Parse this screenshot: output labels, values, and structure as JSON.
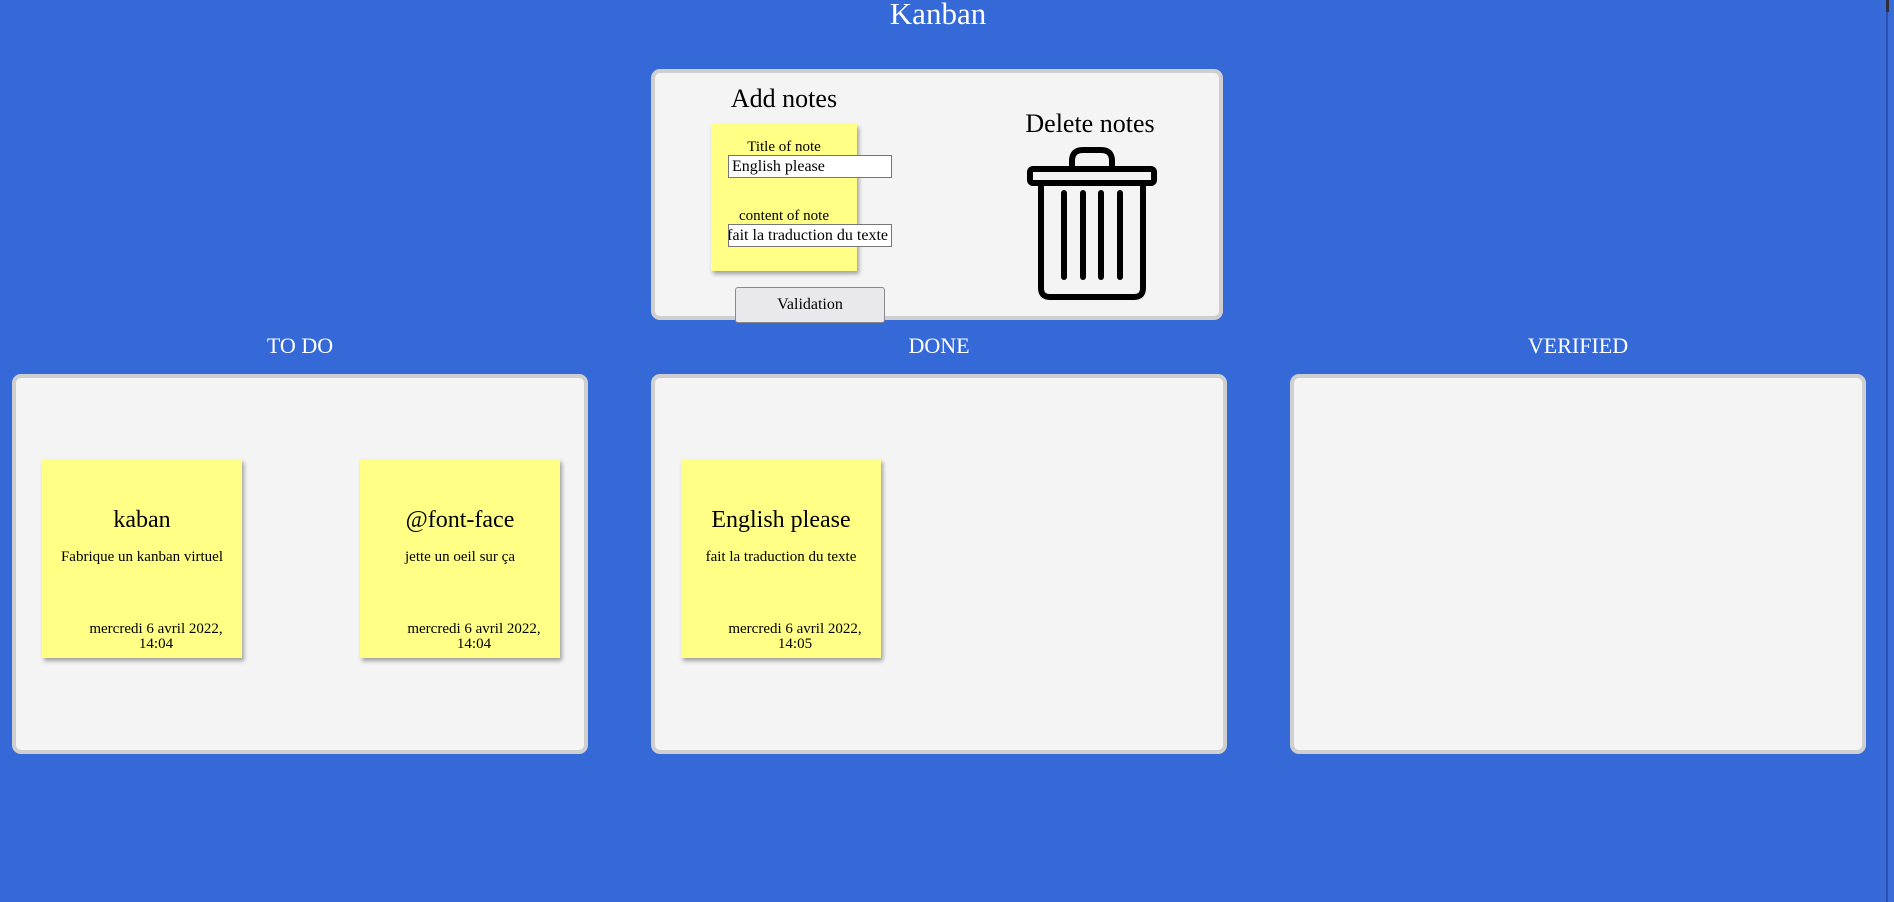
{
  "page": {
    "title": "Kanban",
    "colors": {
      "background": "#3669d8",
      "panel": "#f4f4f4",
      "panel_border": "#cfcfcf",
      "note": "#ffff85"
    }
  },
  "add_notes": {
    "heading": "Add notes",
    "title_label": "Title of note",
    "title_value": "English please",
    "content_label": "content of note",
    "content_value": "fait la traduction du texte",
    "submit_label": "Validation"
  },
  "delete_notes": {
    "heading": "Delete notes",
    "icon": "trash-icon"
  },
  "columns": [
    {
      "title": "TO DO",
      "notes": [
        {
          "title": "kaban",
          "content": "Fabrique un kanban virtuel",
          "date_line1": "mercredi 6 avril 2022,",
          "date_line2": "14:04"
        },
        {
          "title": "@font-face",
          "content": "jette un oeil sur ça",
          "date_line1": "mercredi 6 avril 2022,",
          "date_line2": "14:04"
        }
      ]
    },
    {
      "title": "DONE",
      "notes": [
        {
          "title": "English please",
          "content": "fait la traduction du texte",
          "date_line1": "mercredi 6 avril 2022,",
          "date_line2": "14:05"
        }
      ]
    },
    {
      "title": "VERIFIED",
      "notes": []
    }
  ]
}
